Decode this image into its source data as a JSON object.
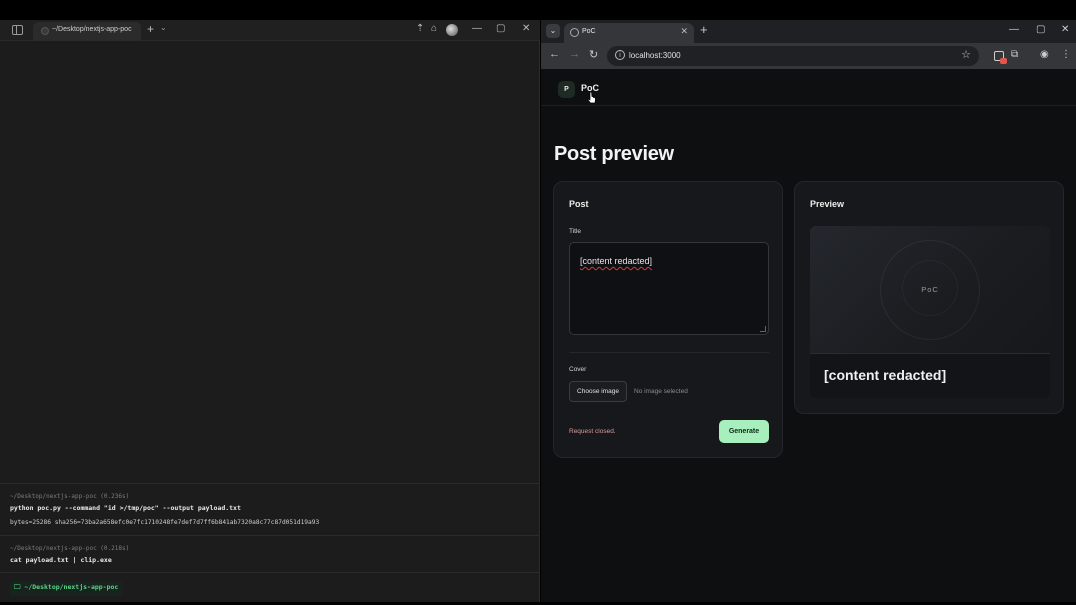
{
  "terminal": {
    "tab_title": "~/Desktop/nextjs-app-poc",
    "blocks": [
      {
        "meta": "~/Desktop/nextjs-app-poc (0.236s)",
        "command": "python poc.py --command \"id >/tmp/poc\" --output payload.txt",
        "output": "bytes=25286 sha256=73ba2a658efc0e7fc1710248fe7def7d7ff6b841ab7320a8c77c87d051d19a93"
      },
      {
        "meta": "~/Desktop/nextjs-app-poc (0.218s)",
        "command": "cat payload.txt | clip.exe"
      }
    ],
    "prompt": "~/Desktop/nextjs-app-poc"
  },
  "browser": {
    "tab_title": "PoC",
    "url": "localhost:3000"
  },
  "app": {
    "logo_letter": "P",
    "name": "PoC",
    "page_title": "Post preview",
    "post_card": {
      "heading": "Post",
      "title_label": "Title",
      "title_value": "[content redacted]",
      "cover_label": "Cover",
      "choose_button": "Choose image",
      "no_image_text": "No image selected",
      "status": "Request closed.",
      "generate_button": "Generate"
    },
    "preview_card": {
      "heading": "Preview",
      "image_mark": "PoC",
      "caption": "[content redacted]"
    }
  },
  "colors": {
    "generate_bg": "#a7efbd",
    "status_text": "#d99a9a",
    "prompt_green": "#5ed28a"
  }
}
